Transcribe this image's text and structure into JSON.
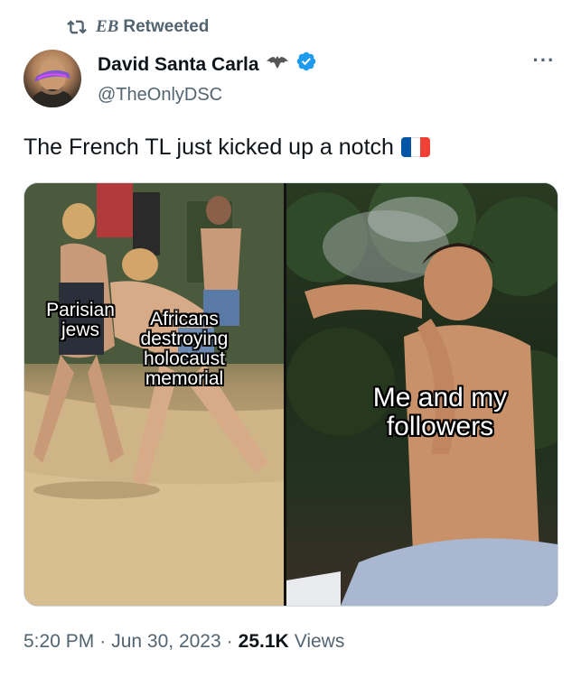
{
  "retweet": {
    "icon": "retweet-icon",
    "retweeter": "EB",
    "label": "Retweeted"
  },
  "author": {
    "name": "David Santa Carla",
    "handle": "@TheOnlyDSC",
    "badge_icon": "batman-emblem-icon",
    "verified_icon": "verified-badge-icon",
    "verified_color": "#1d9bf0"
  },
  "more_icon": "more-options-icon",
  "more_label": "···",
  "tweet": {
    "text": "The French TL just kicked up a notch",
    "emoji": "flag-france-icon"
  },
  "media": {
    "left_labels": {
      "parisian": "Parisian\njews",
      "africans": "Africans\ndestroying\nholocaust\nmemorial"
    },
    "right_label": "Me and my\nfollowers"
  },
  "meta": {
    "time": "5:20 PM",
    "separator1": "·",
    "date": "Jun 30, 2023",
    "separator2": "·",
    "views_count": "25.1K",
    "views_label": "Views"
  },
  "colors": {
    "secondary_text": "#536471",
    "primary_text": "#0f1419",
    "flag_blue": "#0055a4",
    "flag_white": "#ffffff",
    "flag_red": "#ef4135"
  }
}
